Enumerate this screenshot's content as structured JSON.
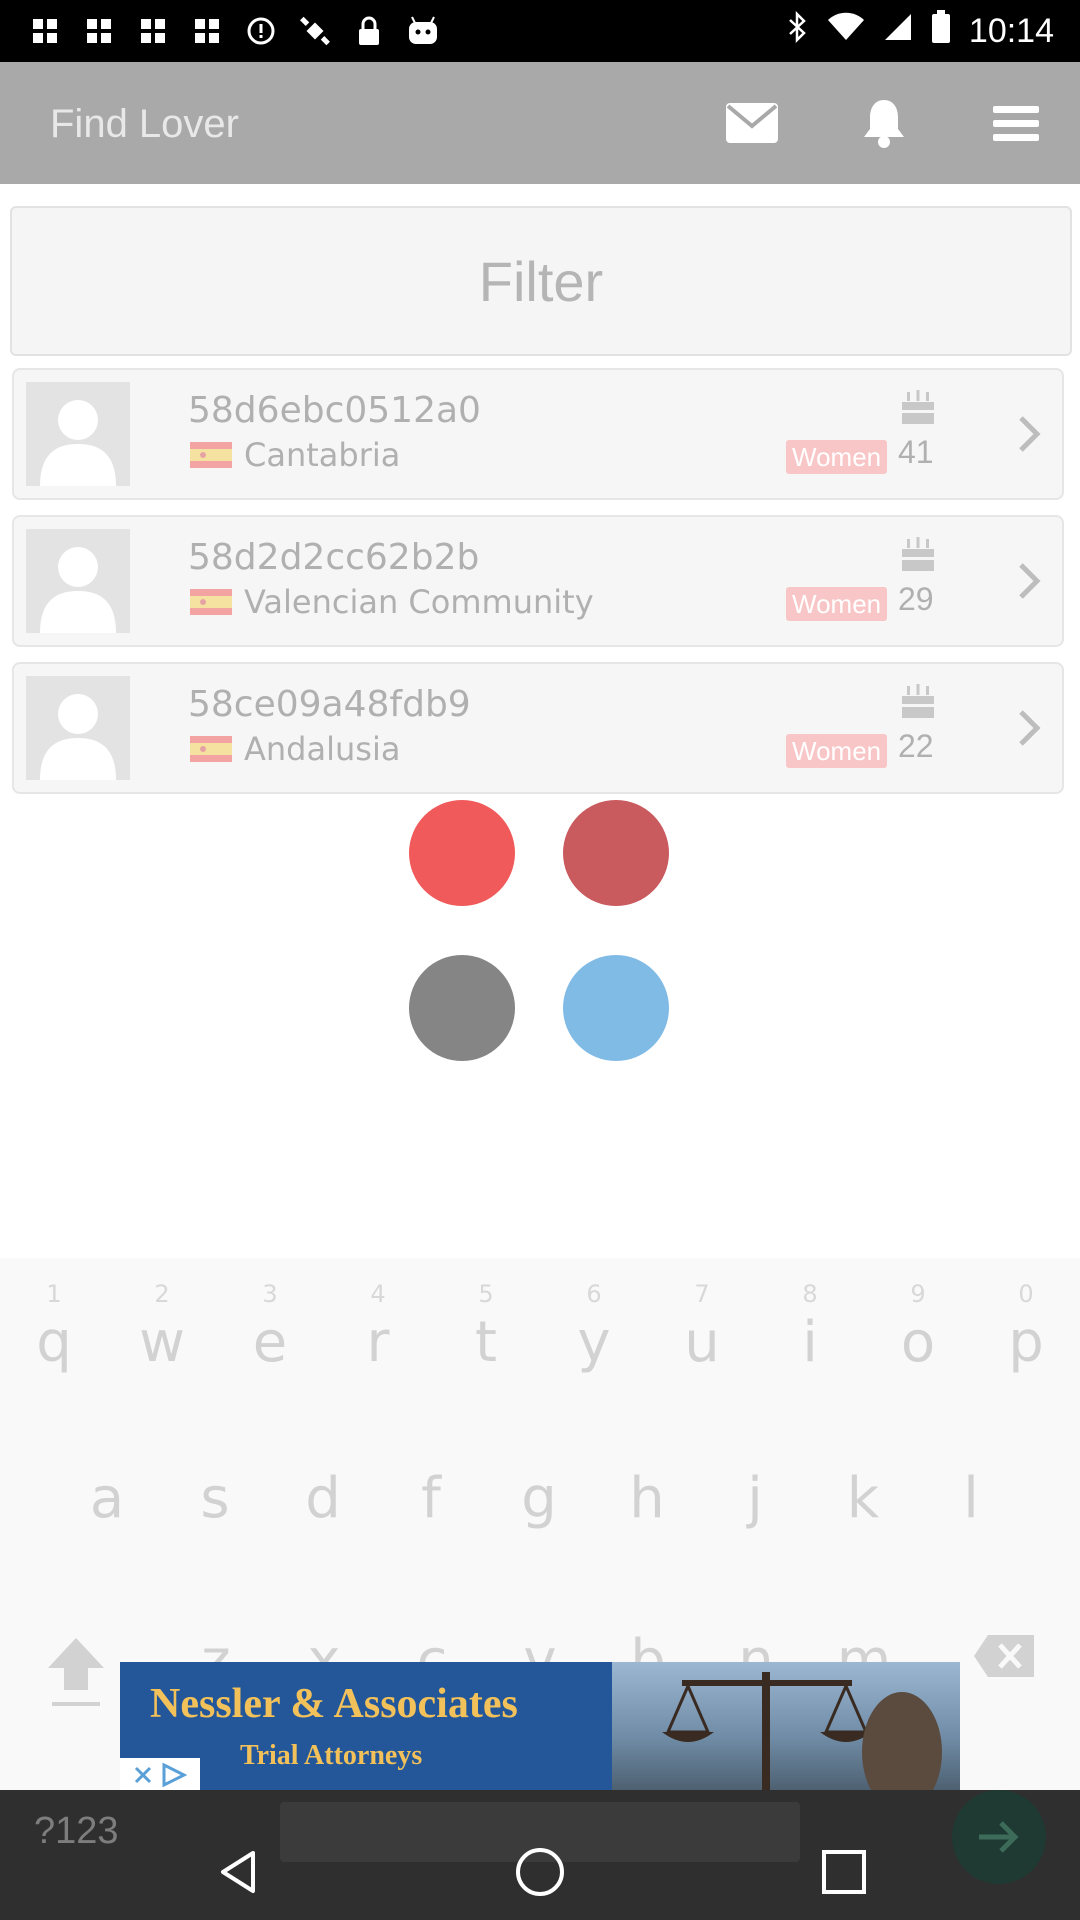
{
  "status_bar": {
    "time": "10:14",
    "icons_left": [
      "news-icon",
      "news-icon",
      "news-icon",
      "news-icon",
      "alert-icon",
      "satellite-icon",
      "lock-icon",
      "android-icon"
    ],
    "icons_right": [
      "bluetooth-icon",
      "wifi-icon",
      "signal-icon",
      "battery-icon"
    ]
  },
  "app_bar": {
    "title": "Find Lover",
    "actions": [
      "mail-icon",
      "bell-icon",
      "menu-icon"
    ]
  },
  "filter": {
    "label": "Filter"
  },
  "profiles": [
    {
      "username": "58d6ebc0512a0",
      "region": "Cantabria",
      "gender": "Women",
      "age": "41"
    },
    {
      "username": "58d2d2cc62b2b",
      "region": "Valencian Community",
      "gender": "Women",
      "age": "29"
    },
    {
      "username": "58ce09a48fdb9",
      "region": "Andalusia",
      "gender": "Women",
      "age": "22"
    }
  ],
  "loader": {
    "colors": [
      "#f05a5a",
      "#c95a5e",
      "#858585",
      "#80bbe6"
    ]
  },
  "keyboard": {
    "row1": [
      {
        "k": "q",
        "h": "1"
      },
      {
        "k": "w",
        "h": "2"
      },
      {
        "k": "e",
        "h": "3"
      },
      {
        "k": "r",
        "h": "4"
      },
      {
        "k": "t",
        "h": "5"
      },
      {
        "k": "y",
        "h": "6"
      },
      {
        "k": "u",
        "h": "7"
      },
      {
        "k": "i",
        "h": "8"
      },
      {
        "k": "o",
        "h": "9"
      },
      {
        "k": "p",
        "h": "0"
      }
    ],
    "row2": [
      "a",
      "s",
      "d",
      "f",
      "g",
      "h",
      "j",
      "k",
      "l"
    ],
    "row3": [
      "z",
      "x",
      "c",
      "v",
      "b",
      "n",
      "m"
    ],
    "symbols_key": "?123"
  },
  "ad": {
    "line1": "Nessler & Associates",
    "line2": "Trial Attorneys"
  }
}
